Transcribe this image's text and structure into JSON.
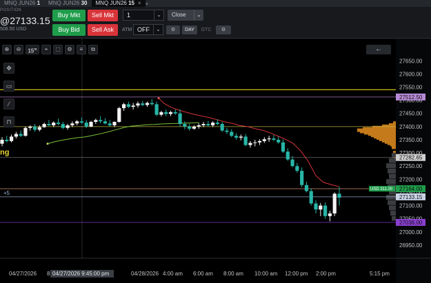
{
  "tabs": [
    {
      "name": "MNQ JUN26",
      "interval": "1",
      "active": false
    },
    {
      "name": "MNQ JUN26",
      "interval": "30",
      "active": false
    },
    {
      "name": "MNQ JUN26",
      "interval": "15",
      "active": true
    }
  ],
  "tab_close_icon": "×",
  "tab_add_icon": "+",
  "position": {
    "label": "POSITION",
    "price": "@27133.15",
    "sub": "508.50 USD"
  },
  "order": {
    "buy_mkt": "Buy Mkt",
    "sell_mkt": "Sell Mkt",
    "buy_bid": "Buy Bid",
    "sell_ask": "Sell Ask",
    "quantity": "1",
    "close": "Close",
    "atm_label": "ATM",
    "atm_value": "OFF",
    "tif_day": "DAY",
    "tif_gtc": "GTC"
  },
  "toolbar": {
    "interval": "15",
    "interval_unit": "m",
    "icons": [
      "zoom-in-icon",
      "zoom-out-icon",
      "interval-button",
      "crosshair-icon",
      "marquee-icon",
      "settings-icon",
      "copy-icon"
    ]
  },
  "chart_data": {
    "type": "candlestick",
    "instrument": "MNQ JUN26",
    "ylim": [
      26900,
      27690
    ],
    "y_ticks": [
      "27650.00",
      "27600.00",
      "27550.00",
      "27500.00",
      "27450.00",
      "27400.00",
      "27350.00",
      "27300.00",
      "27250.00",
      "27200.00",
      "27150.00",
      "27100.00",
      "27050.00",
      "27000.00",
      "26950.00"
    ],
    "x_ticks": [
      "04/27/2026",
      "8",
      "04/28/2026",
      "4:00 am",
      "6:00 am",
      "8:00 am",
      "10:00 am",
      "12:00 pm",
      "2:00 pm",
      "5:15 pm"
    ],
    "crosshair_time": "04/27/2026 9:45:00 pm",
    "price_labels": [
      {
        "price": "27512.50",
        "color": "#b68ad6"
      },
      {
        "price": "27282.65",
        "color": "#d0d0d0"
      },
      {
        "price": "27164.00",
        "color": "#1f9d4b",
        "tag": "USD 311.00"
      },
      {
        "price": "27133.15",
        "color": "#c9d3e6"
      },
      {
        "price": "27036.00",
        "color": "#8a3fd1"
      }
    ],
    "levels": [
      {
        "price": 27540,
        "color": "#d6c21e"
      },
      {
        "price": 27512.5,
        "color": "#b68ad6"
      },
      {
        "price": 27400,
        "color": "#c9c24a"
      },
      {
        "price": 27282.65,
        "color": "#777777"
      },
      {
        "price": 27164,
        "color": "#c98a6a"
      },
      {
        "price": 27133.15,
        "color": "#9fb4d8"
      },
      {
        "price": 27036,
        "color": "#8a3fd1"
      }
    ],
    "left_labels": {
      "ng": "ng",
      "plus5": "+5"
    },
    "candles": [
      [
        27335,
        27360,
        27325,
        27350
      ],
      [
        27350,
        27365,
        27340,
        27345
      ],
      [
        27345,
        27370,
        27340,
        27362
      ],
      [
        27362,
        27380,
        27355,
        27372
      ],
      [
        27372,
        27385,
        27360,
        27365
      ],
      [
        27365,
        27400,
        27362,
        27395
      ],
      [
        27395,
        27405,
        27385,
        27400
      ],
      [
        27400,
        27410,
        27380,
        27388
      ],
      [
        27388,
        27405,
        27382,
        27398
      ],
      [
        27398,
        27415,
        27395,
        27410
      ],
      [
        27410,
        27425,
        27402,
        27405
      ],
      [
        27405,
        27420,
        27398,
        27415
      ],
      [
        27415,
        27430,
        27405,
        27410
      ],
      [
        27410,
        27418,
        27390,
        27395
      ],
      [
        27395,
        27410,
        27388,
        27405
      ],
      [
        27405,
        27420,
        27398,
        27412
      ],
      [
        27412,
        27425,
        27405,
        27420
      ],
      [
        27420,
        27435,
        27410,
        27415
      ],
      [
        27415,
        27425,
        27395,
        27400
      ],
      [
        27400,
        27422,
        27398,
        27418
      ],
      [
        27418,
        27430,
        27410,
        27425
      ],
      [
        27425,
        27440,
        27412,
        27420
      ],
      [
        27420,
        27432,
        27408,
        27412
      ],
      [
        27412,
        27425,
        27400,
        27405
      ],
      [
        27405,
        27420,
        27398,
        27418
      ],
      [
        27418,
        27475,
        27415,
        27470
      ],
      [
        27470,
        27490,
        27460,
        27485
      ],
      [
        27485,
        27495,
        27470,
        27475
      ],
      [
        27475,
        27490,
        27465,
        27480
      ],
      [
        27480,
        27495,
        27472,
        27488
      ],
      [
        27488,
        27498,
        27478,
        27482
      ],
      [
        27482,
        27495,
        27475,
        27490
      ],
      [
        27490,
        27505,
        27480,
        27485
      ],
      [
        27485,
        27495,
        27440,
        27445
      ],
      [
        27445,
        27460,
        27438,
        27455
      ],
      [
        27455,
        27465,
        27440,
        27448
      ],
      [
        27448,
        27460,
        27440,
        27455
      ],
      [
        27455,
        27465,
        27445,
        27450
      ],
      [
        27450,
        27465,
        27400,
        27410
      ],
      [
        27410,
        27420,
        27390,
        27400
      ],
      [
        27400,
        27410,
        27385,
        27392
      ],
      [
        27392,
        27405,
        27388,
        27400
      ],
      [
        27400,
        27412,
        27392,
        27405
      ],
      [
        27405,
        27418,
        27398,
        27410
      ],
      [
        27410,
        27422,
        27400,
        27405
      ],
      [
        27405,
        27420,
        27398,
        27415
      ],
      [
        27415,
        27428,
        27405,
        27410
      ],
      [
        27410,
        27418,
        27380,
        27385
      ],
      [
        27385,
        27395,
        27372,
        27380
      ],
      [
        27380,
        27390,
        27360,
        27365
      ],
      [
        27365,
        27375,
        27350,
        27358
      ],
      [
        27358,
        27370,
        27348,
        27362
      ],
      [
        27362,
        27372,
        27325,
        27330
      ],
      [
        27330,
        27345,
        27320,
        27338
      ],
      [
        27338,
        27350,
        27325,
        27340
      ],
      [
        27340,
        27352,
        27330,
        27345
      ],
      [
        27345,
        27360,
        27338,
        27352
      ],
      [
        27352,
        27365,
        27342,
        27355
      ],
      [
        27355,
        27368,
        27345,
        27350
      ],
      [
        27350,
        27362,
        27335,
        27340
      ],
      [
        27340,
        27352,
        27300,
        27305
      ],
      [
        27305,
        27318,
        27270,
        27275
      ],
      [
        27275,
        27288,
        27245,
        27250
      ],
      [
        27250,
        27262,
        27225,
        27232
      ],
      [
        27232,
        27245,
        27170,
        27178
      ],
      [
        27178,
        27190,
        27150,
        27155
      ],
      [
        27155,
        27165,
        27100,
        27108
      ],
      [
        27108,
        27120,
        27070,
        27085
      ],
      [
        27085,
        27110,
        27060,
        27100
      ],
      [
        27100,
        27112,
        27050,
        27060
      ],
      [
        27060,
        27080,
        27040,
        27070
      ],
      [
        27070,
        27150,
        27060,
        27145
      ],
      [
        27145,
        27172,
        27100,
        27130
      ]
    ],
    "vwap": [
      [
        11,
        27335
      ],
      [
        22,
        27343
      ],
      [
        33,
        27349
      ],
      [
        44,
        27354
      ],
      [
        55,
        27358
      ],
      [
        66,
        27361
      ],
      [
        77,
        27367
      ],
      [
        88,
        27373
      ],
      [
        99,
        27380
      ],
      [
        110,
        27388
      ],
      [
        121,
        27396
      ],
      [
        132,
        27402
      ],
      [
        143,
        27404
      ],
      [
        154,
        27407
      ],
      [
        165,
        27408
      ],
      [
        176,
        27410
      ],
      [
        187,
        27411
      ],
      [
        198,
        27412
      ],
      [
        209,
        27413
      ],
      [
        220,
        27414
      ],
      [
        231,
        27415
      ]
    ],
    "trail_stop": [
      [
        230,
        27508
      ],
      [
        238,
        27488
      ],
      [
        249,
        27472
      ],
      [
        260,
        27462
      ],
      [
        271,
        27454
      ],
      [
        282,
        27446
      ],
      [
        293,
        27440
      ],
      [
        304,
        27434
      ],
      [
        315,
        27426
      ],
      [
        326,
        27418
      ],
      [
        337,
        27412
      ],
      [
        348,
        27404
      ],
      [
        359,
        27400
      ],
      [
        370,
        27392
      ],
      [
        381,
        27386
      ],
      [
        392,
        27376
      ],
      [
        403,
        27364
      ],
      [
        414,
        27352
      ],
      [
        425,
        27336
      ],
      [
        436,
        27308
      ],
      [
        447,
        27268
      ],
      [
        458,
        27214
      ],
      [
        469,
        27188
      ],
      [
        480,
        27180
      ],
      [
        491,
        27172
      ]
    ],
    "volume_profile": [
      [
        27412,
        4
      ],
      [
        27405,
        10
      ],
      [
        27400,
        20
      ],
      [
        27395,
        34
      ],
      [
        27390,
        48
      ],
      [
        27385,
        56
      ],
      [
        27380,
        52
      ],
      [
        27375,
        46
      ],
      [
        27370,
        40
      ],
      [
        27365,
        36
      ],
      [
        27360,
        32
      ],
      [
        27355,
        28
      ],
      [
        27350,
        24
      ],
      [
        27345,
        20
      ],
      [
        27340,
        16
      ],
      [
        27335,
        12
      ],
      [
        27330,
        8
      ],
      [
        27320,
        6
      ],
      [
        27300,
        4
      ],
      [
        27280,
        3
      ]
    ],
    "gray_profile": [
      [
        27290,
        6
      ],
      [
        27270,
        10
      ],
      [
        27250,
        14
      ],
      [
        27230,
        12
      ],
      [
        27210,
        10
      ],
      [
        27190,
        14
      ],
      [
        27170,
        12
      ],
      [
        27150,
        10
      ],
      [
        27130,
        14
      ],
      [
        27110,
        12
      ],
      [
        27090,
        10
      ],
      [
        27070,
        8
      ],
      [
        27050,
        6
      ]
    ]
  }
}
